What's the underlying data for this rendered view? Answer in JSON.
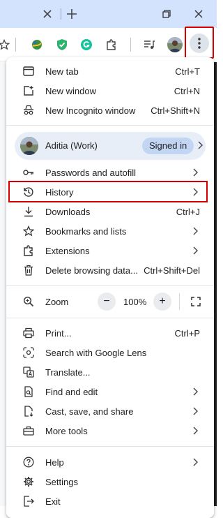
{
  "titlebar": {
    "icons": [
      "close-tab-icon",
      "new-tab-icon",
      "restore-icon",
      "close-window-icon"
    ]
  },
  "toolbar": {
    "icons": [
      "bookmark-star-icon",
      "extension-globe-icon",
      "shield-extension-icon",
      "grammarly-icon",
      "extensions-puzzle-icon",
      "media-queue-icon",
      "profile-avatar",
      "more-menu-icon"
    ]
  },
  "menu": {
    "new_tab": {
      "label": "New tab",
      "shortcut": "Ctrl+T"
    },
    "new_window": {
      "label": "New window",
      "shortcut": "Ctrl+N"
    },
    "incognito": {
      "label": "New Incognito window",
      "shortcut": "Ctrl+Shift+N"
    },
    "profile": {
      "name": "Aditia (Work)",
      "status": "Signed in"
    },
    "passwords": {
      "label": "Passwords and autofill"
    },
    "history": {
      "label": "History"
    },
    "downloads": {
      "label": "Downloads",
      "shortcut": "Ctrl+J"
    },
    "bookmarks": {
      "label": "Bookmarks and lists"
    },
    "extensions": {
      "label": "Extensions"
    },
    "delete_data": {
      "label": "Delete browsing data...",
      "shortcut": "Ctrl+Shift+Del"
    },
    "zoom": {
      "label": "Zoom",
      "minus": "−",
      "value": "100%",
      "plus": "+"
    },
    "print": {
      "label": "Print...",
      "shortcut": "Ctrl+P"
    },
    "lens": {
      "label": "Search with Google Lens"
    },
    "translate": {
      "label": "Translate..."
    },
    "find_edit": {
      "label": "Find and edit"
    },
    "cast_save": {
      "label": "Cast, save, and share"
    },
    "more_tools": {
      "label": "More tools"
    },
    "help": {
      "label": "Help"
    },
    "settings": {
      "label": "Settings"
    },
    "exit": {
      "label": "Exit"
    }
  },
  "colors": {
    "titlebar_bg": "#d3e3fd",
    "highlight_red": "#d40000",
    "profile_bg": "#e8eef7",
    "badge_bg": "#c2d6f4"
  }
}
